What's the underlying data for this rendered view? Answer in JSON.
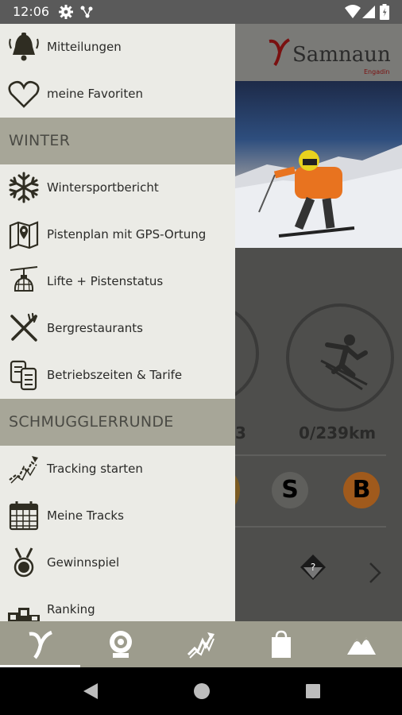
{
  "statusbar": {
    "time": "12:06"
  },
  "background": {
    "logo_text": "Samnaun",
    "logo_sub": "Engadin",
    "stat_left": "3",
    "stat_right": "0/239km",
    "badge_s": "S",
    "badge_b": "B"
  },
  "drawer": {
    "items_top": [
      {
        "label": "Mitteilungen",
        "icon": "bell-icon"
      },
      {
        "label": "meine Favoriten",
        "icon": "heart-icon"
      }
    ],
    "winter_header": "WINTER",
    "winter_items": [
      {
        "label": "Wintersportbericht",
        "icon": "snowflake-icon"
      },
      {
        "label": "Pistenplan mit GPS-Ortung",
        "icon": "map-pin-icon"
      },
      {
        "label": "Lifte + Pistenstatus",
        "icon": "gondola-icon"
      },
      {
        "label": "Bergrestaurants",
        "icon": "fork-knife-icon"
      },
      {
        "label": "Betriebszeiten & Tarife",
        "icon": "ticket-icon"
      }
    ],
    "schmuggler_header": "SCHMUGGLERRUNDE",
    "schmuggler_items": [
      {
        "label": "Tracking starten",
        "icon": "tracking-icon"
      },
      {
        "label": "Meine Tracks",
        "icon": "calendar-icon"
      },
      {
        "label": "Gewinnspiel",
        "icon": "medal-icon"
      },
      {
        "label": "Ranking",
        "icon": "podium-icon"
      }
    ]
  },
  "tabs": [
    {
      "name": "home-tab",
      "icon": "samnaun-logo-icon",
      "active": true
    },
    {
      "name": "webcam-tab",
      "icon": "webcam-icon"
    },
    {
      "name": "tracking-tab",
      "icon": "tracking-icon"
    },
    {
      "name": "shop-tab",
      "icon": "shopping-bag-icon"
    },
    {
      "name": "mountains-tab",
      "icon": "mountain-icon"
    }
  ],
  "colors": {
    "drawer_bg": "#ebebe6",
    "section_bg": "#a7a698",
    "tabbar_bg": "#9d9c8d",
    "accent_orange": "#c8741e"
  }
}
